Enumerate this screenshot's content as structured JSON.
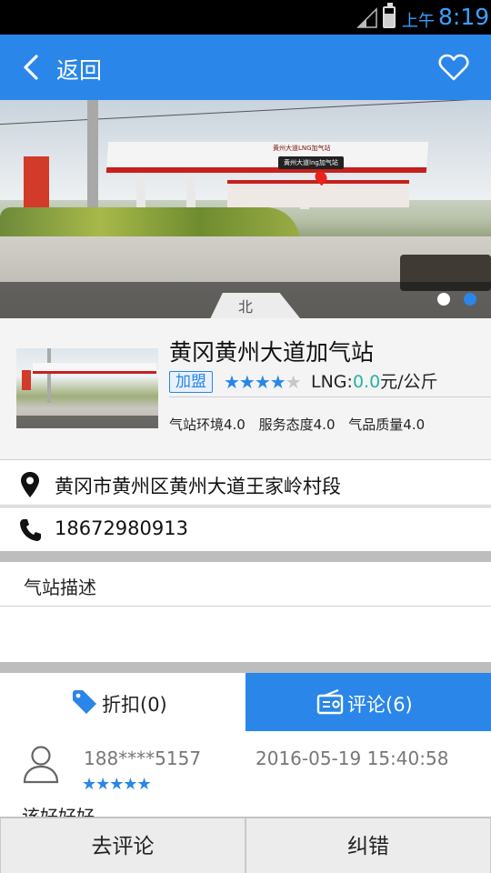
{
  "status_bar": {
    "ampm": "上午",
    "time": "8:19"
  },
  "header": {
    "back_label": "返回",
    "back_icon": "chevron-left-icon",
    "favorite_icon": "heart-outline-icon"
  },
  "banner": {
    "canopy_text": "黄州大道LNG加气站",
    "map_label": "黄州大道lng加气站",
    "compass_label": "北",
    "page_count": 2,
    "active_page": 2
  },
  "station": {
    "name": "黄冈黄州大道加气站",
    "badge": "加盟",
    "rating": 4,
    "rating_max": 5,
    "price_label": "LNG:",
    "price_value": "0.0",
    "price_unit": "元/公斤",
    "score_env": "气站环境4.0",
    "score_service": "服务态度4.0",
    "score_quality": "气品质量4.0"
  },
  "address": {
    "icon": "location-pin-icon",
    "text": "黄冈市黄州区黄州大道王家岭村段"
  },
  "phone": {
    "icon": "phone-icon",
    "text": "18672980913"
  },
  "description": {
    "title": "气站描述"
  },
  "tabs": {
    "discount": {
      "label": "折扣(0)",
      "icon": "tag-icon"
    },
    "review": {
      "label": "评论(6)",
      "icon": "radio-comment-icon"
    },
    "active": "review"
  },
  "review": {
    "user": "188****5157",
    "time": "2016-05-19 15:40:58",
    "rating": 5,
    "content": "该好好好"
  },
  "bottom_bar": {
    "review_button": "去评论",
    "correct_button": "纠错"
  },
  "colors": {
    "primary": "#2a86e8",
    "price": "#2ab3a0",
    "background": "#f4f4f4"
  }
}
